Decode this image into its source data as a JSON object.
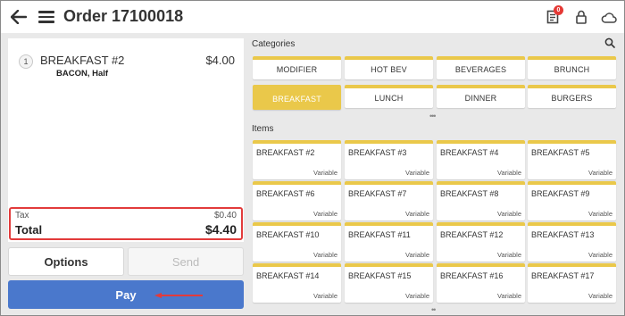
{
  "header": {
    "title": "Order 17100018",
    "notification_count": "0"
  },
  "order": {
    "items": [
      {
        "qty": "1",
        "name": "BREAKFAST #2",
        "price": "$4.00",
        "modifier": "BACON, Half"
      }
    ],
    "tax_label": "Tax",
    "tax_value": "$0.40",
    "total_label": "Total",
    "total_value": "$4.40"
  },
  "actions": {
    "options_label": "Options",
    "send_label": "Send",
    "pay_label": "Pay"
  },
  "categories": {
    "label": "Categories",
    "items": [
      "MODIFIER",
      "HOT BEV",
      "BEVERAGES",
      "BRUNCH",
      "BREAKFAST",
      "LUNCH",
      "DINNER",
      "BURGERS"
    ],
    "selected": "BREAKFAST"
  },
  "menu_items": {
    "label": "Items",
    "items": [
      {
        "name": "BREAKFAST #2",
        "price": "Variable"
      },
      {
        "name": "BREAKFAST #3",
        "price": "Variable"
      },
      {
        "name": "BREAKFAST #4",
        "price": "Variable"
      },
      {
        "name": "BREAKFAST #5",
        "price": "Variable"
      },
      {
        "name": "BREAKFAST #6",
        "price": "Variable"
      },
      {
        "name": "BREAKFAST #7",
        "price": "Variable"
      },
      {
        "name": "BREAKFAST #8",
        "price": "Variable"
      },
      {
        "name": "BREAKFAST #9",
        "price": "Variable"
      },
      {
        "name": "BREAKFAST #10",
        "price": "Variable"
      },
      {
        "name": "BREAKFAST #11",
        "price": "Variable"
      },
      {
        "name": "BREAKFAST #12",
        "price": "Variable"
      },
      {
        "name": "BREAKFAST #13",
        "price": "Variable"
      },
      {
        "name": "BREAKFAST #14",
        "price": "Variable"
      },
      {
        "name": "BREAKFAST #15",
        "price": "Variable"
      },
      {
        "name": "BREAKFAST #16",
        "price": "Variable"
      },
      {
        "name": "BREAKFAST #17",
        "price": "Variable"
      }
    ]
  },
  "colors": {
    "accent_yellow": "#eac84a",
    "pay_blue": "#4a78cc",
    "highlight_red": "#e23b3b"
  },
  "icons": {
    "back": "back-arrow-icon",
    "menu": "hamburger-menu-icon",
    "receipt": "receipt-icon",
    "lock": "lock-icon",
    "cloud": "cloud-icon",
    "search": "search-icon"
  }
}
